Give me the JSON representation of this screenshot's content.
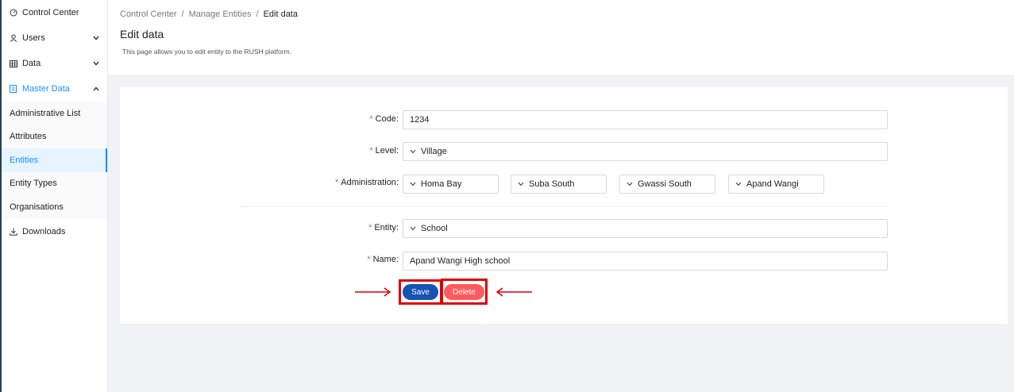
{
  "sidebar": {
    "items": [
      {
        "label": "Control Center",
        "icon": "dashboard-icon"
      },
      {
        "label": "Users",
        "icon": "user-icon"
      },
      {
        "label": "Data",
        "icon": "table-icon"
      },
      {
        "label": "Master Data",
        "icon": "book-icon"
      }
    ],
    "submenu": [
      "Administrative List",
      "Attributes",
      "Entities",
      "Entity Types",
      "Organisations"
    ],
    "selected_submenu": "Entities",
    "downloads": {
      "label": "Downloads",
      "icon": "download-icon"
    }
  },
  "breadcrumb": {
    "items": [
      "Control Center",
      "Manage Entities",
      "Edit data"
    ],
    "separator": "/"
  },
  "page": {
    "title": "Edit data",
    "description": "This page allows you to edit entity to the RUSH platform."
  },
  "form": {
    "required_mark": "*",
    "code": {
      "label": "Code",
      "value": "1234"
    },
    "level": {
      "label": "Level",
      "value": "Village"
    },
    "administration": {
      "label": "Administration",
      "values": [
        "Homa Bay",
        "Suba South",
        "Gwassi South",
        "Apand Wangi"
      ]
    },
    "entity": {
      "label": "Entity",
      "value": "School"
    },
    "name": {
      "label": "Name",
      "value": "Apand Wangi High school"
    },
    "label_suffix": ":"
  },
  "buttons": {
    "save": "Save",
    "delete": "Delete"
  },
  "colors": {
    "accent": "#1890ff",
    "save": "#1553b5",
    "delete": "#ff5a5f",
    "highlight": "#e00000",
    "required": "#ff4d4f"
  }
}
